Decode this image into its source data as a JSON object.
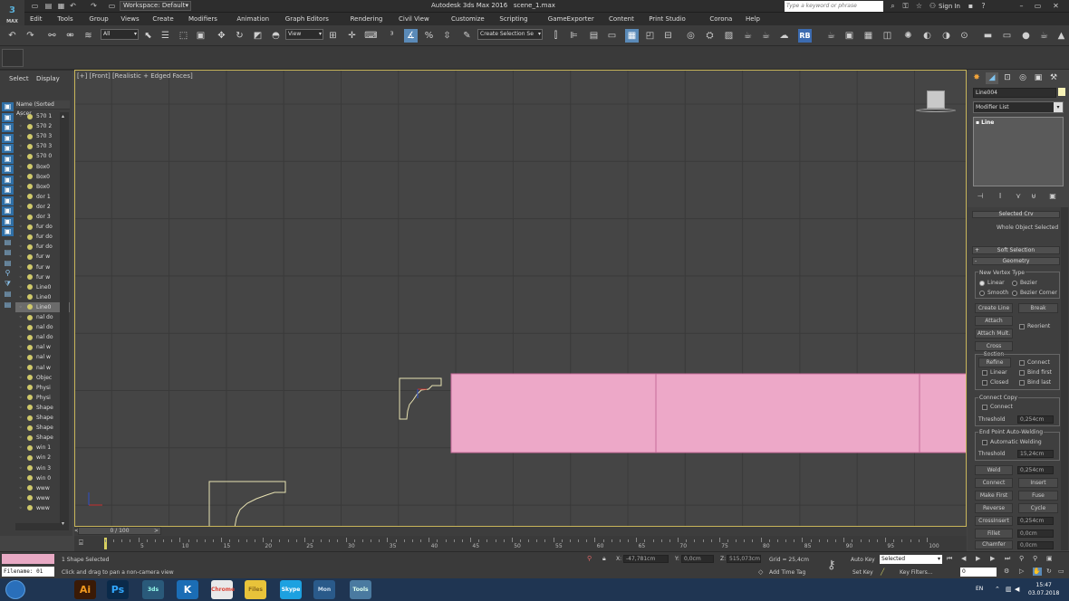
{
  "title_bar": {
    "logo": "MAX",
    "workspace": "Workspace: Default",
    "app_title": "Autodesk 3ds Max 2016",
    "file_title": "scene_1.max",
    "search_placeholder": "Type a keyword or phrase",
    "sign_in": "Sign In",
    "help_icon": "?"
  },
  "menu": [
    "Edit",
    "Tools",
    "Group",
    "Views",
    "Create",
    "Modifiers",
    "Animation",
    "Graph Editors",
    "Rendering",
    "Civil View",
    "Customize",
    "Scripting",
    "GameExporter",
    "Content",
    "Print Studio",
    "Corona",
    "Help"
  ],
  "toolbar": {
    "selection_filter": "All",
    "ref_coord": "View",
    "named_selection": "Create Selection Se",
    "rb_label": "RB"
  },
  "scene_explorer": {
    "tabs": [
      "Select",
      "Display"
    ],
    "column_header": "Name (Sorted Ascer",
    "rows": [
      "570 1",
      "570 2",
      "570 3",
      "570 3",
      "570 0",
      "Box0",
      "Box0",
      "Box0",
      "dor 1",
      "dor 2",
      "dor 3",
      "fur do",
      "fur do",
      "fur do",
      "fur w",
      "fur w",
      "fur w",
      "Line0",
      "Line0",
      "Line0",
      "nal do",
      "nal do",
      "nal do",
      "nal w",
      "nal w",
      "nal w",
      "Objec",
      "Physi",
      "Physi",
      "Shape",
      "Shape",
      "Shape",
      "Shape",
      "win 1",
      "win 2",
      "win 3",
      "win 0",
      "www",
      "www",
      "www"
    ],
    "selected_row": 19
  },
  "viewport": {
    "label": "[+] [Front] [Realistic + Edged Faces]",
    "view_cube_label": "FRONT",
    "pink_color": "#eda8c8",
    "shape_color": "#e8e2b2",
    "gizmo_x_color": "#c83030",
    "gizmo_y_color": "#3050c8"
  },
  "command_panel": {
    "object_name": "Line004",
    "object_color": "#f7f2b6",
    "modifier_list": "Modifier List",
    "stack_item": "Line",
    "selected_crv": "Selected Crv",
    "whole_object": "Whole Object Selected",
    "soft_selection": "Soft Selection",
    "geometry": "Geometry",
    "new_vertex_type": "New Vertex Type",
    "linear": "Linear",
    "bezier": "Bezier",
    "smooth": "Smooth",
    "bezier_corner": "Bezier Corner",
    "create_line": "Create Line",
    "break": "Break",
    "attach": "Attach",
    "reorient": "Reorient",
    "attach_mult": "Attach Mult.",
    "cross_section": "Cross Section",
    "refine": "Refine",
    "connect": "Connect",
    "linear2": "Linear",
    "bind_first": "Bind first",
    "closed": "Closed",
    "bind_last": "Bind last",
    "connect_copy": "Connect Copy",
    "connect2": "Connect",
    "threshold": "Threshold",
    "threshold_val": "0,254cm",
    "end_point_welding": "End Point Auto-Welding",
    "auto_welding": "Automatic Welding",
    "threshold2": "Threshold",
    "threshold2_val": "15,24cm",
    "weld": "Weld",
    "weld_val": "0,254cm",
    "connect3": "Connect",
    "insert": "Insert",
    "make_first": "Make First",
    "fuse": "Fuse",
    "reverse": "Reverse",
    "cycle": "Cycle",
    "cross_insert": "CrossInsert",
    "cross_insert_val": "0,254cm",
    "fillet": "Fillet",
    "fillet_val": "0,0cm",
    "chamfer": "Chamfer",
    "chamfer_val": "0,0cm"
  },
  "timeline": {
    "slider": "0 / 100",
    "ticks": [
      "5",
      "10",
      "15",
      "20",
      "25",
      "30",
      "35",
      "40",
      "45",
      "50",
      "55",
      "60",
      "65",
      "70",
      "75",
      "80",
      "85",
      "90",
      "95",
      "100"
    ]
  },
  "status": {
    "filename": "Filename: 01",
    "selection": "1 Shape Selected",
    "prompt": "Click and drag to pan a non-camera view",
    "x_label": "X:",
    "x_val": "-47,781cm",
    "y_label": "Y:",
    "y_val": "0,0cm",
    "z_label": "Z:",
    "z_val": "515,073cm",
    "grid": "Grid = 25,4cm",
    "add_time_tag": "Add Time Tag",
    "auto_key": "Auto Key",
    "set_key": "Set Key",
    "key_mode": "Selected",
    "key_filters": "Key Filters...",
    "frame": "0"
  },
  "taskbar": {
    "apps": [
      "Ai",
      "Ps",
      "3ds",
      "K",
      "Chrome",
      "Files",
      "Skype",
      "Mon",
      "Tools"
    ],
    "lang": "EN",
    "time": "15:47",
    "date": "03.07.2018"
  }
}
